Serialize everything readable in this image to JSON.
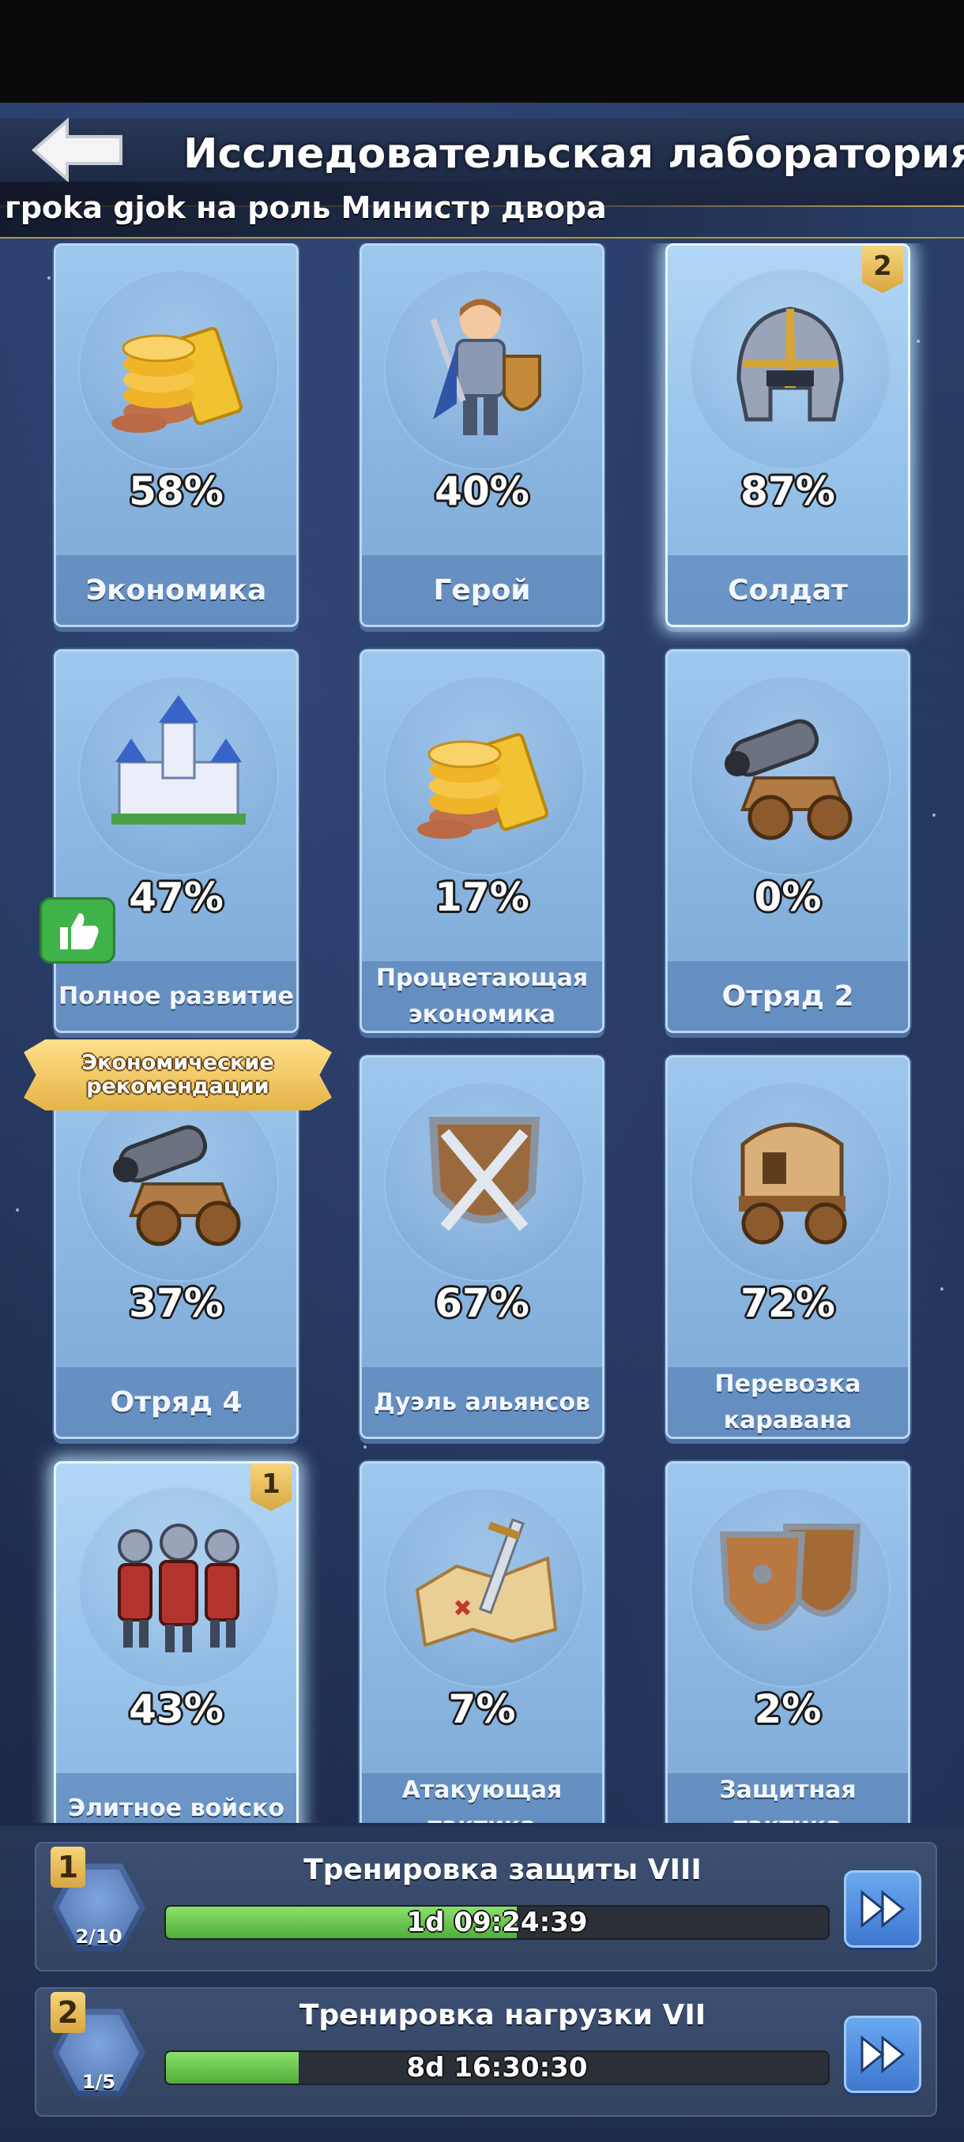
{
  "header": {
    "title": "Исследовательская лаборатория",
    "ticker": "гроkа gjok на роль Министр двора"
  },
  "cards": [
    {
      "label": "Экономика",
      "percent": "58%",
      "icon": "gold-coins-icon"
    },
    {
      "label": "Герой",
      "percent": "40%",
      "icon": "hero-knight-icon"
    },
    {
      "label": "Солдат",
      "percent": "87%",
      "icon": "soldier-helmet-icon",
      "badge": "2"
    },
    {
      "label": "Полное развитие",
      "percent": "47%",
      "icon": "castle-icon",
      "ribbon": [
        "Экономические",
        "рекомендации"
      ]
    },
    {
      "label": "Процветающая экономика",
      "percent": "17%",
      "icon": "gold-coins-icon"
    },
    {
      "label": "Отряд 2",
      "percent": "0%",
      "icon": "cannon-icon"
    },
    {
      "label": "Отряд 4",
      "percent": "37%",
      "icon": "cannon-icon"
    },
    {
      "label": "Дуэль альянсов",
      "percent": "67%",
      "icon": "crossed-swords-shield-icon"
    },
    {
      "label": "Перевозка каравана",
      "percent": "72%",
      "icon": "caravan-wagon-icon"
    },
    {
      "label": "Элитное войско",
      "percent": "43%",
      "icon": "elite-troops-icon",
      "badge": "1"
    },
    {
      "label": "Атакующая тактика",
      "percent": "7%",
      "icon": "attack-map-sword-icon"
    },
    {
      "label": "Защитная тактика",
      "percent": "2%",
      "icon": "defense-shields-icon"
    }
  ],
  "queue": [
    {
      "slot": "1",
      "count": "2/10",
      "title": "Тренировка защиты VIII",
      "timer": "1d 09:24:39",
      "progress": 0.53
    },
    {
      "slot": "2",
      "count": "1/5",
      "title": "Тренировка нагрузки VII",
      "timer": "8d 16:30:30",
      "progress": 0.2
    }
  ],
  "colors": {
    "accent_gold": "#e4b448",
    "progress_green": "#4fae3a",
    "card_blue": "#8cb7e2"
  }
}
